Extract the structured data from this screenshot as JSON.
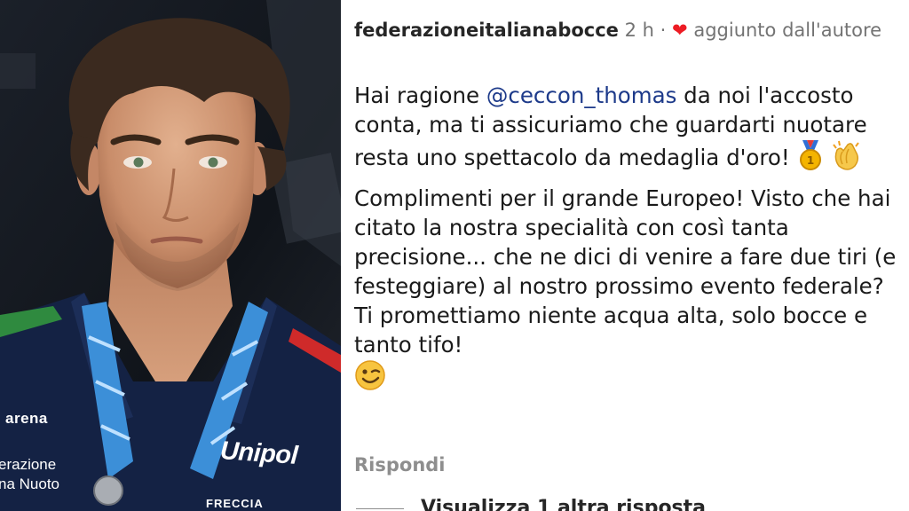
{
  "photo": {
    "brand_arena": "arena",
    "brand_federation": "erazione\nna Nuoto",
    "brand_unipol": "Unipol",
    "brand_frecce": "FRECCIA"
  },
  "comment": {
    "username": "federazioneitalianabocce",
    "time": "2 h",
    "separator": "·",
    "liked_icon": "heart-icon",
    "liked_label": "aggiunto dall'autore",
    "paragraph1_before": "Hai ragione ",
    "mention": "@ceccon_thomas",
    "paragraph1_after": " da noi l'accosto conta, ma ti assicuriamo che guardarti nuotare resta uno spettacolo da medaglia d'oro! ",
    "paragraph1_emojis": [
      "gold-medal-emoji",
      "clapping-hands-emoji"
    ],
    "paragraph2": "Complimenti per il grande Europeo! Visto che hai citato la nostra specialità con così tanta precisione... che ne dici di venire a fare due tiri (e festeggiare) al nostro prossimo evento federale? Ti promettiamo niente acqua alta, solo bocce e tanto tifo!",
    "paragraph2_emoji": "winking-face-emoji",
    "reply_label": "Rispondi",
    "more_replies": "Visualizza 1 altra risposta"
  },
  "colors": {
    "mention": "#1d3a8a",
    "heart": "#ed1c24",
    "meta_gray": "#737373"
  }
}
